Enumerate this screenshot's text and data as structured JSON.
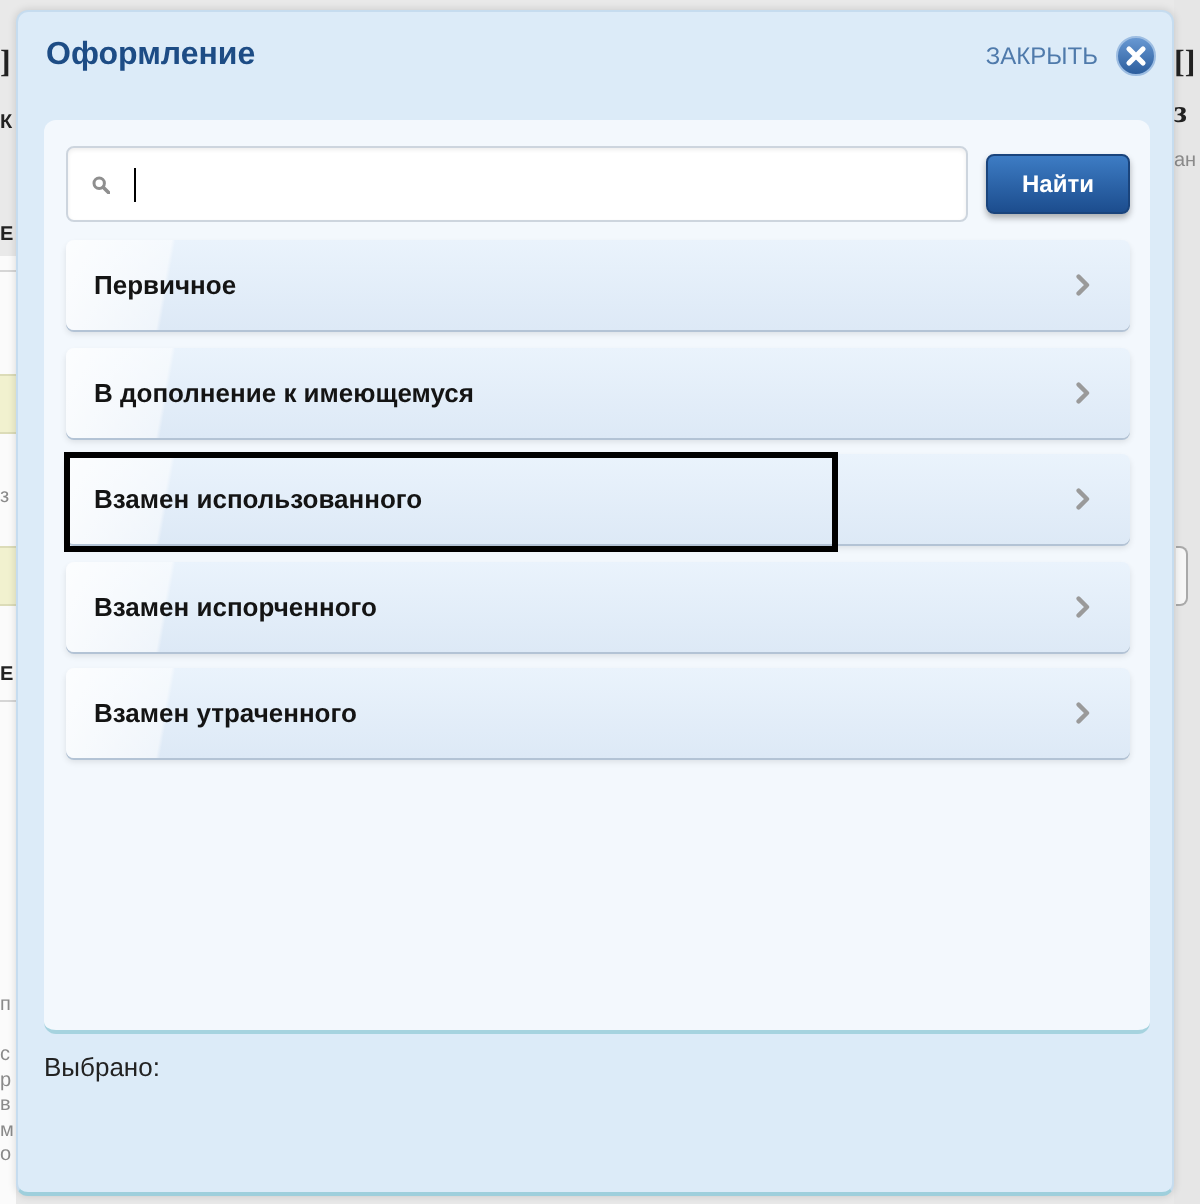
{
  "background_page": {
    "left_fragments": [
      {
        "text": "]",
        "kind": "heading"
      },
      {
        "text": "К",
        "kind": "label"
      },
      {
        "text": "Е",
        "kind": "label"
      },
      {
        "text": "з",
        "kind": "text"
      },
      {
        "text": "Е",
        "kind": "label"
      },
      {
        "text": "п",
        "kind": "text"
      },
      {
        "text": "с",
        "kind": "text"
      },
      {
        "text": "р",
        "kind": "text"
      },
      {
        "text": "в",
        "kind": "text"
      },
      {
        "text": "м",
        "kind": "text"
      },
      {
        "text": "о",
        "kind": "text"
      }
    ],
    "right_fragments": [
      {
        "text": "[]",
        "kind": "heading"
      },
      {
        "text": "з",
        "kind": "heading"
      },
      {
        "text": "ан",
        "kind": "text"
      }
    ]
  },
  "dialog": {
    "title": "Оформление",
    "close_label": "ЗАКРЫТЬ",
    "search": {
      "focused": true
    },
    "search_button": "Найти",
    "options": [
      {
        "label": "Первичное",
        "highlighted": false
      },
      {
        "label": "В дополнение к имеющемуся",
        "highlighted": false
      },
      {
        "label": "Взамен использованного",
        "highlighted": true
      },
      {
        "label": "Взамен испорченного",
        "highlighted": false
      },
      {
        "label": "Взамен утраченного",
        "highlighted": false
      }
    ],
    "selected_label": "Выбрано:"
  }
}
